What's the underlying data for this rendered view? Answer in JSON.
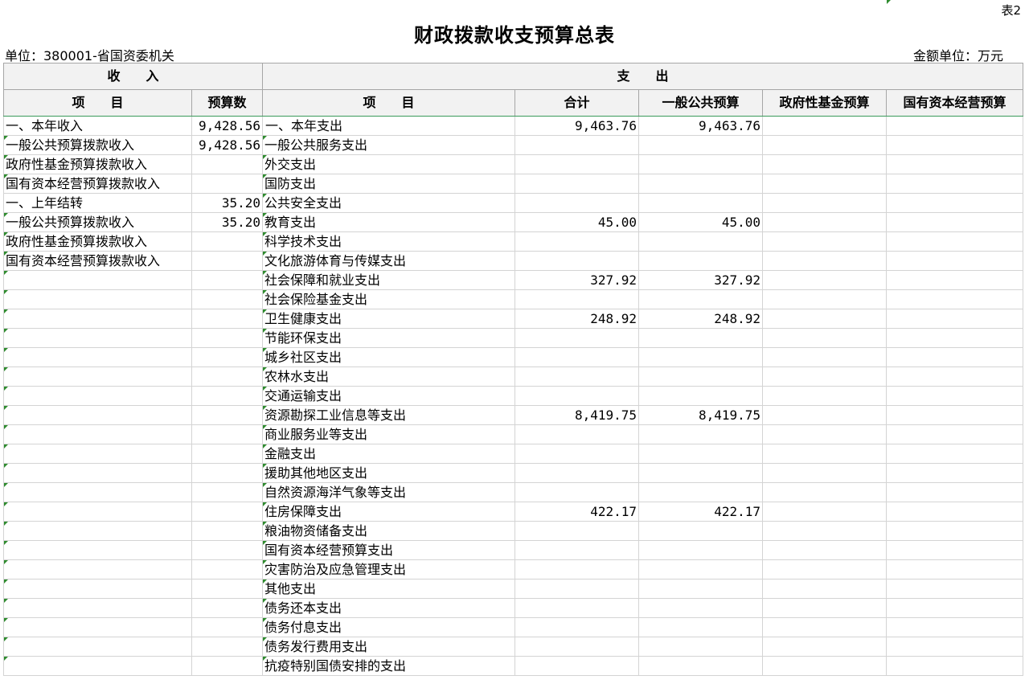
{
  "sheet_label": "表2",
  "title": "财政拨款收支预算总表",
  "unit_left": "单位：380001-省国资委机关",
  "unit_right": "金额单位：万元",
  "headers": {
    "income_group": "收　　入",
    "expense_group": "支　　出",
    "income_item": "项　　目",
    "income_budget": "预算数",
    "expense_item": "项　　目",
    "total": "合计",
    "general_public": "一般公共预算",
    "gov_fund": "政府性基金预算",
    "state_capital": "国有资本经营预算"
  },
  "rows": [
    {
      "income_item": "一、本年收入",
      "income_level": 1,
      "income_value": "9,428.56",
      "expense_item": "一、本年支出",
      "expense_top": true,
      "total": "9,463.76",
      "general": "9,463.76",
      "fund": "",
      "capital": ""
    },
    {
      "income_item": "一般公共预算拨款收入",
      "income_level": 2,
      "income_value": "9,428.56",
      "expense_item": "一般公共服务支出",
      "total": "",
      "general": "",
      "fund": "",
      "capital": ""
    },
    {
      "income_item": "政府性基金预算拨款收入",
      "income_level": 2,
      "income_value": "",
      "expense_item": "外交支出",
      "total": "",
      "general": "",
      "fund": "",
      "capital": ""
    },
    {
      "income_item": "国有资本经营预算拨款收入",
      "income_level": 2,
      "income_value": "",
      "expense_item": "国防支出",
      "total": "",
      "general": "",
      "fund": "",
      "capital": ""
    },
    {
      "income_item": "一、上年结转",
      "income_level": 1,
      "income_value": "35.20",
      "expense_item": "公共安全支出",
      "total": "",
      "general": "",
      "fund": "",
      "capital": ""
    },
    {
      "income_item": "一般公共预算拨款收入",
      "income_level": 2,
      "income_value": "35.20",
      "expense_item": "教育支出",
      "total": "45.00",
      "general": "45.00",
      "fund": "",
      "capital": ""
    },
    {
      "income_item": "政府性基金预算拨款收入",
      "income_level": 2,
      "income_value": "",
      "expense_item": "科学技术支出",
      "total": "",
      "general": "",
      "fund": "",
      "capital": ""
    },
    {
      "income_item": "国有资本经营预算拨款收入",
      "income_level": 2,
      "income_value": "",
      "expense_item": "文化旅游体育与传媒支出",
      "total": "",
      "general": "",
      "fund": "",
      "capital": ""
    },
    {
      "income_item": "",
      "income_level": 2,
      "income_value": "",
      "expense_item": "社会保障和就业支出",
      "total": "327.92",
      "general": "327.92",
      "fund": "",
      "capital": ""
    },
    {
      "income_item": "",
      "income_level": 2,
      "income_value": "",
      "expense_item": "社会保险基金支出",
      "total": "",
      "general": "",
      "fund": "",
      "capital": ""
    },
    {
      "income_item": "",
      "income_level": 2,
      "income_value": "",
      "expense_item": "卫生健康支出",
      "total": "248.92",
      "general": "248.92",
      "fund": "",
      "capital": ""
    },
    {
      "income_item": "",
      "income_level": 2,
      "income_value": "",
      "expense_item": "节能环保支出",
      "total": "",
      "general": "",
      "fund": "",
      "capital": ""
    },
    {
      "income_item": "",
      "income_level": 2,
      "income_value": "",
      "expense_item": "城乡社区支出",
      "total": "",
      "general": "",
      "fund": "",
      "capital": ""
    },
    {
      "income_item": "",
      "income_level": 2,
      "income_value": "",
      "expense_item": "农林水支出",
      "total": "",
      "general": "",
      "fund": "",
      "capital": ""
    },
    {
      "income_item": "",
      "income_level": 2,
      "income_value": "",
      "expense_item": "交通运输支出",
      "total": "",
      "general": "",
      "fund": "",
      "capital": ""
    },
    {
      "income_item": "",
      "income_level": 2,
      "income_value": "",
      "expense_item": "资源勘探工业信息等支出",
      "total": "8,419.75",
      "general": "8,419.75",
      "fund": "",
      "capital": ""
    },
    {
      "income_item": "",
      "income_level": 2,
      "income_value": "",
      "expense_item": "商业服务业等支出",
      "total": "",
      "general": "",
      "fund": "",
      "capital": ""
    },
    {
      "income_item": "",
      "income_level": 2,
      "income_value": "",
      "expense_item": "金融支出",
      "total": "",
      "general": "",
      "fund": "",
      "capital": ""
    },
    {
      "income_item": "",
      "income_level": 2,
      "income_value": "",
      "expense_item": "援助其他地区支出",
      "total": "",
      "general": "",
      "fund": "",
      "capital": ""
    },
    {
      "income_item": "",
      "income_level": 2,
      "income_value": "",
      "expense_item": "自然资源海洋气象等支出",
      "total": "",
      "general": "",
      "fund": "",
      "capital": ""
    },
    {
      "income_item": "",
      "income_level": 2,
      "income_value": "",
      "expense_item": "住房保障支出",
      "total": "422.17",
      "general": "422.17",
      "fund": "",
      "capital": ""
    },
    {
      "income_item": "",
      "income_level": 2,
      "income_value": "",
      "expense_item": "粮油物资储备支出",
      "total": "",
      "general": "",
      "fund": "",
      "capital": ""
    },
    {
      "income_item": "",
      "income_level": 2,
      "income_value": "",
      "expense_item": "国有资本经营预算支出",
      "total": "",
      "general": "",
      "fund": "",
      "capital": ""
    },
    {
      "income_item": "",
      "income_level": 2,
      "income_value": "",
      "expense_item": "灾害防治及应急管理支出",
      "total": "",
      "general": "",
      "fund": "",
      "capital": ""
    },
    {
      "income_item": "",
      "income_level": 2,
      "income_value": "",
      "expense_item": "其他支出",
      "total": "",
      "general": "",
      "fund": "",
      "capital": ""
    },
    {
      "income_item": "",
      "income_level": 2,
      "income_value": "",
      "expense_item": "债务还本支出",
      "total": "",
      "general": "",
      "fund": "",
      "capital": ""
    },
    {
      "income_item": "",
      "income_level": 2,
      "income_value": "",
      "expense_item": "债务付息支出",
      "total": "",
      "general": "",
      "fund": "",
      "capital": ""
    },
    {
      "income_item": "",
      "income_level": 2,
      "income_value": "",
      "expense_item": "债务发行费用支出",
      "total": "",
      "general": "",
      "fund": "",
      "capital": ""
    },
    {
      "income_item": "",
      "income_level": 2,
      "income_value": "",
      "expense_item": "抗疫特别国债安排的支出",
      "total": "",
      "general": "",
      "fund": "",
      "capital": ""
    }
  ]
}
